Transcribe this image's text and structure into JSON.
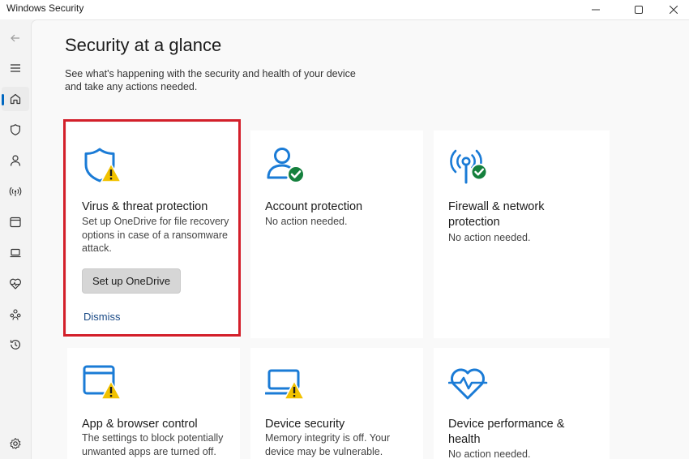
{
  "window": {
    "title": "Windows Security",
    "controls": {
      "minimize": "minimize-icon",
      "maximize": "maximize-icon",
      "close": "close-icon"
    }
  },
  "sidebar": {
    "items": [
      {
        "name": "back",
        "icon": "back-arrow-icon"
      },
      {
        "name": "menu",
        "icon": "hamburger-menu-icon"
      },
      {
        "name": "home",
        "icon": "home-icon",
        "active": true
      },
      {
        "name": "virus",
        "icon": "shield-icon"
      },
      {
        "name": "account",
        "icon": "person-icon"
      },
      {
        "name": "firewall",
        "icon": "wifi-antenna-icon"
      },
      {
        "name": "app-browser",
        "icon": "browser-window-icon"
      },
      {
        "name": "device-security",
        "icon": "laptop-icon"
      },
      {
        "name": "device-health",
        "icon": "heart-pulse-icon"
      },
      {
        "name": "family",
        "icon": "family-icon"
      },
      {
        "name": "history",
        "icon": "history-icon"
      },
      {
        "name": "settings",
        "icon": "gear-icon"
      }
    ]
  },
  "main": {
    "title": "Security at a glance",
    "description": "See what's happening with the security and health of your device and take any actions needed.",
    "cards": [
      {
        "title": "Virus & threat protection",
        "description": "Set up OneDrive for file recovery options in case of a ransomware attack.",
        "button": "Set up OneDrive",
        "link": "Dismiss",
        "status": "warning",
        "icon": "shield-warning-icon"
      },
      {
        "title": "Account protection",
        "description": "No action needed.",
        "status": "ok",
        "icon": "person-check-icon"
      },
      {
        "title": "Firewall & network protection",
        "description": "No action needed.",
        "status": "ok",
        "icon": "antenna-check-icon"
      },
      {
        "title": "App & browser control",
        "description": "The settings to block potentially unwanted apps are turned off.",
        "status": "warning",
        "icon": "browser-warning-icon"
      },
      {
        "title": "Device security",
        "description": "Memory integrity is off. Your device may be vulnerable.",
        "status": "warning",
        "icon": "laptop-warning-icon"
      },
      {
        "title": "Device performance & health",
        "description": "No action needed.",
        "status": "ok",
        "icon": "heart-pulse-icon"
      }
    ]
  },
  "colors": {
    "accent": "#0067c0",
    "icon_blue": "#1a7bd6",
    "warning": "#f2c200",
    "ok": "#15803d",
    "highlight": "#d31f2a"
  }
}
